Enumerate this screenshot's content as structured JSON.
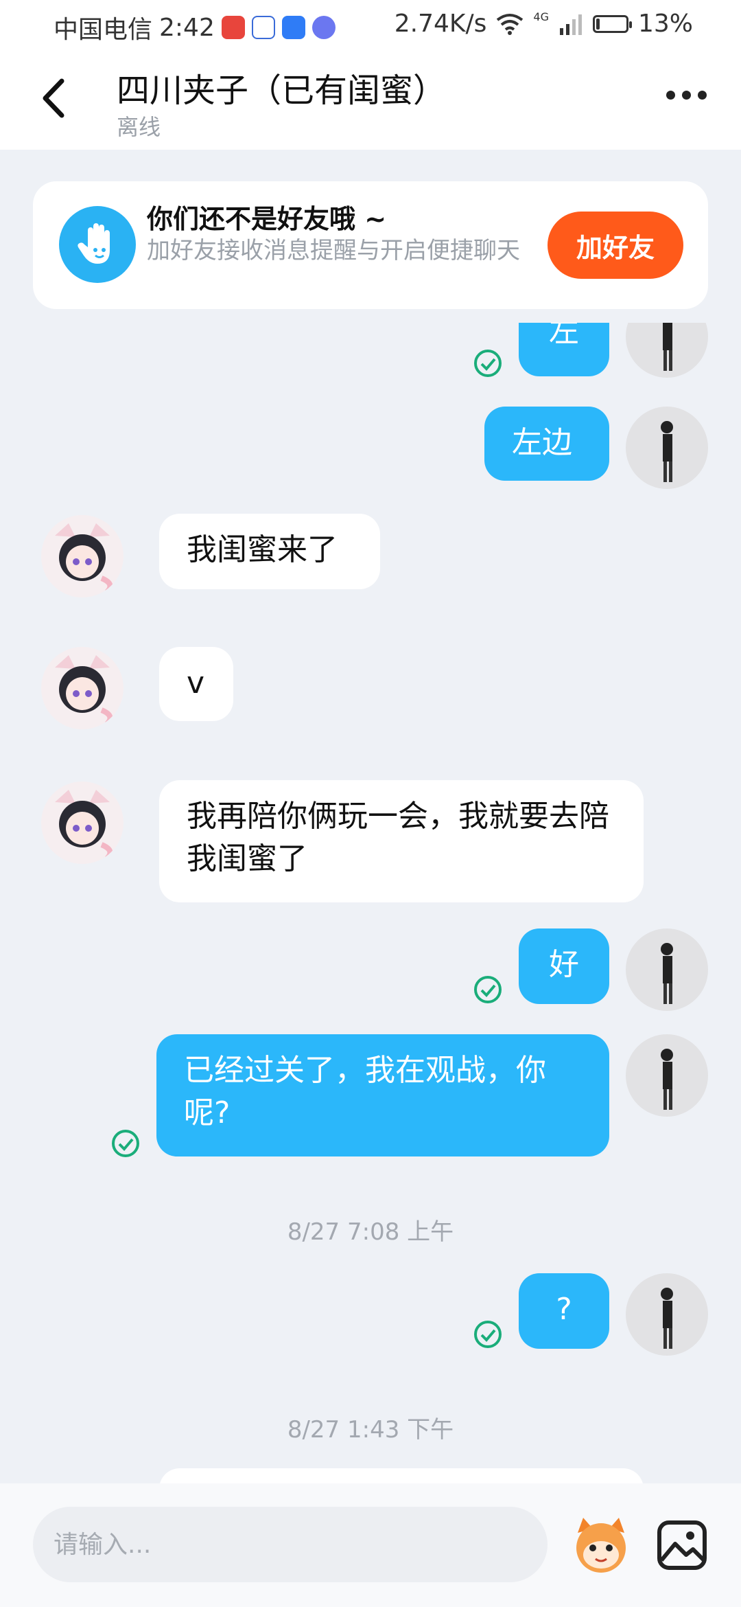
{
  "status_bar": {
    "carrier": "中国电信",
    "time": "2:42",
    "network_speed": "2.74K/s",
    "network_type": "4G",
    "battery": "13%",
    "battery_level": 0.13
  },
  "header": {
    "title": "四川夹子（已有闺蜜）",
    "status": "离线"
  },
  "friend_card": {
    "title": "你们还不是好友哦 ~",
    "description": "加好友接收消息提醒与开启便捷聊天",
    "button": "加好友"
  },
  "messages": [
    {
      "from": "me",
      "text": "左"
    },
    {
      "from": "me",
      "text": "左边"
    },
    {
      "from": "other",
      "text": "我闺蜜来了"
    },
    {
      "from": "other",
      "text": "v"
    },
    {
      "from": "other",
      "text": "我再陪你俩玩一会，我就要去陪我闺蜜了"
    },
    {
      "from": "me",
      "text": "好"
    },
    {
      "from": "me",
      "text": "已经过关了，我在观战，你呢?"
    },
    {
      "from": "me",
      "text": "?"
    }
  ],
  "timestamps": [
    "8/27 7:08 上午",
    "8/27 1:43 下午"
  ],
  "input": {
    "placeholder": "请输入..."
  },
  "colors": {
    "accent_blue": "#2bb7fa",
    "add_button": "#ff5a1a",
    "check_green": "#1aad7a"
  }
}
